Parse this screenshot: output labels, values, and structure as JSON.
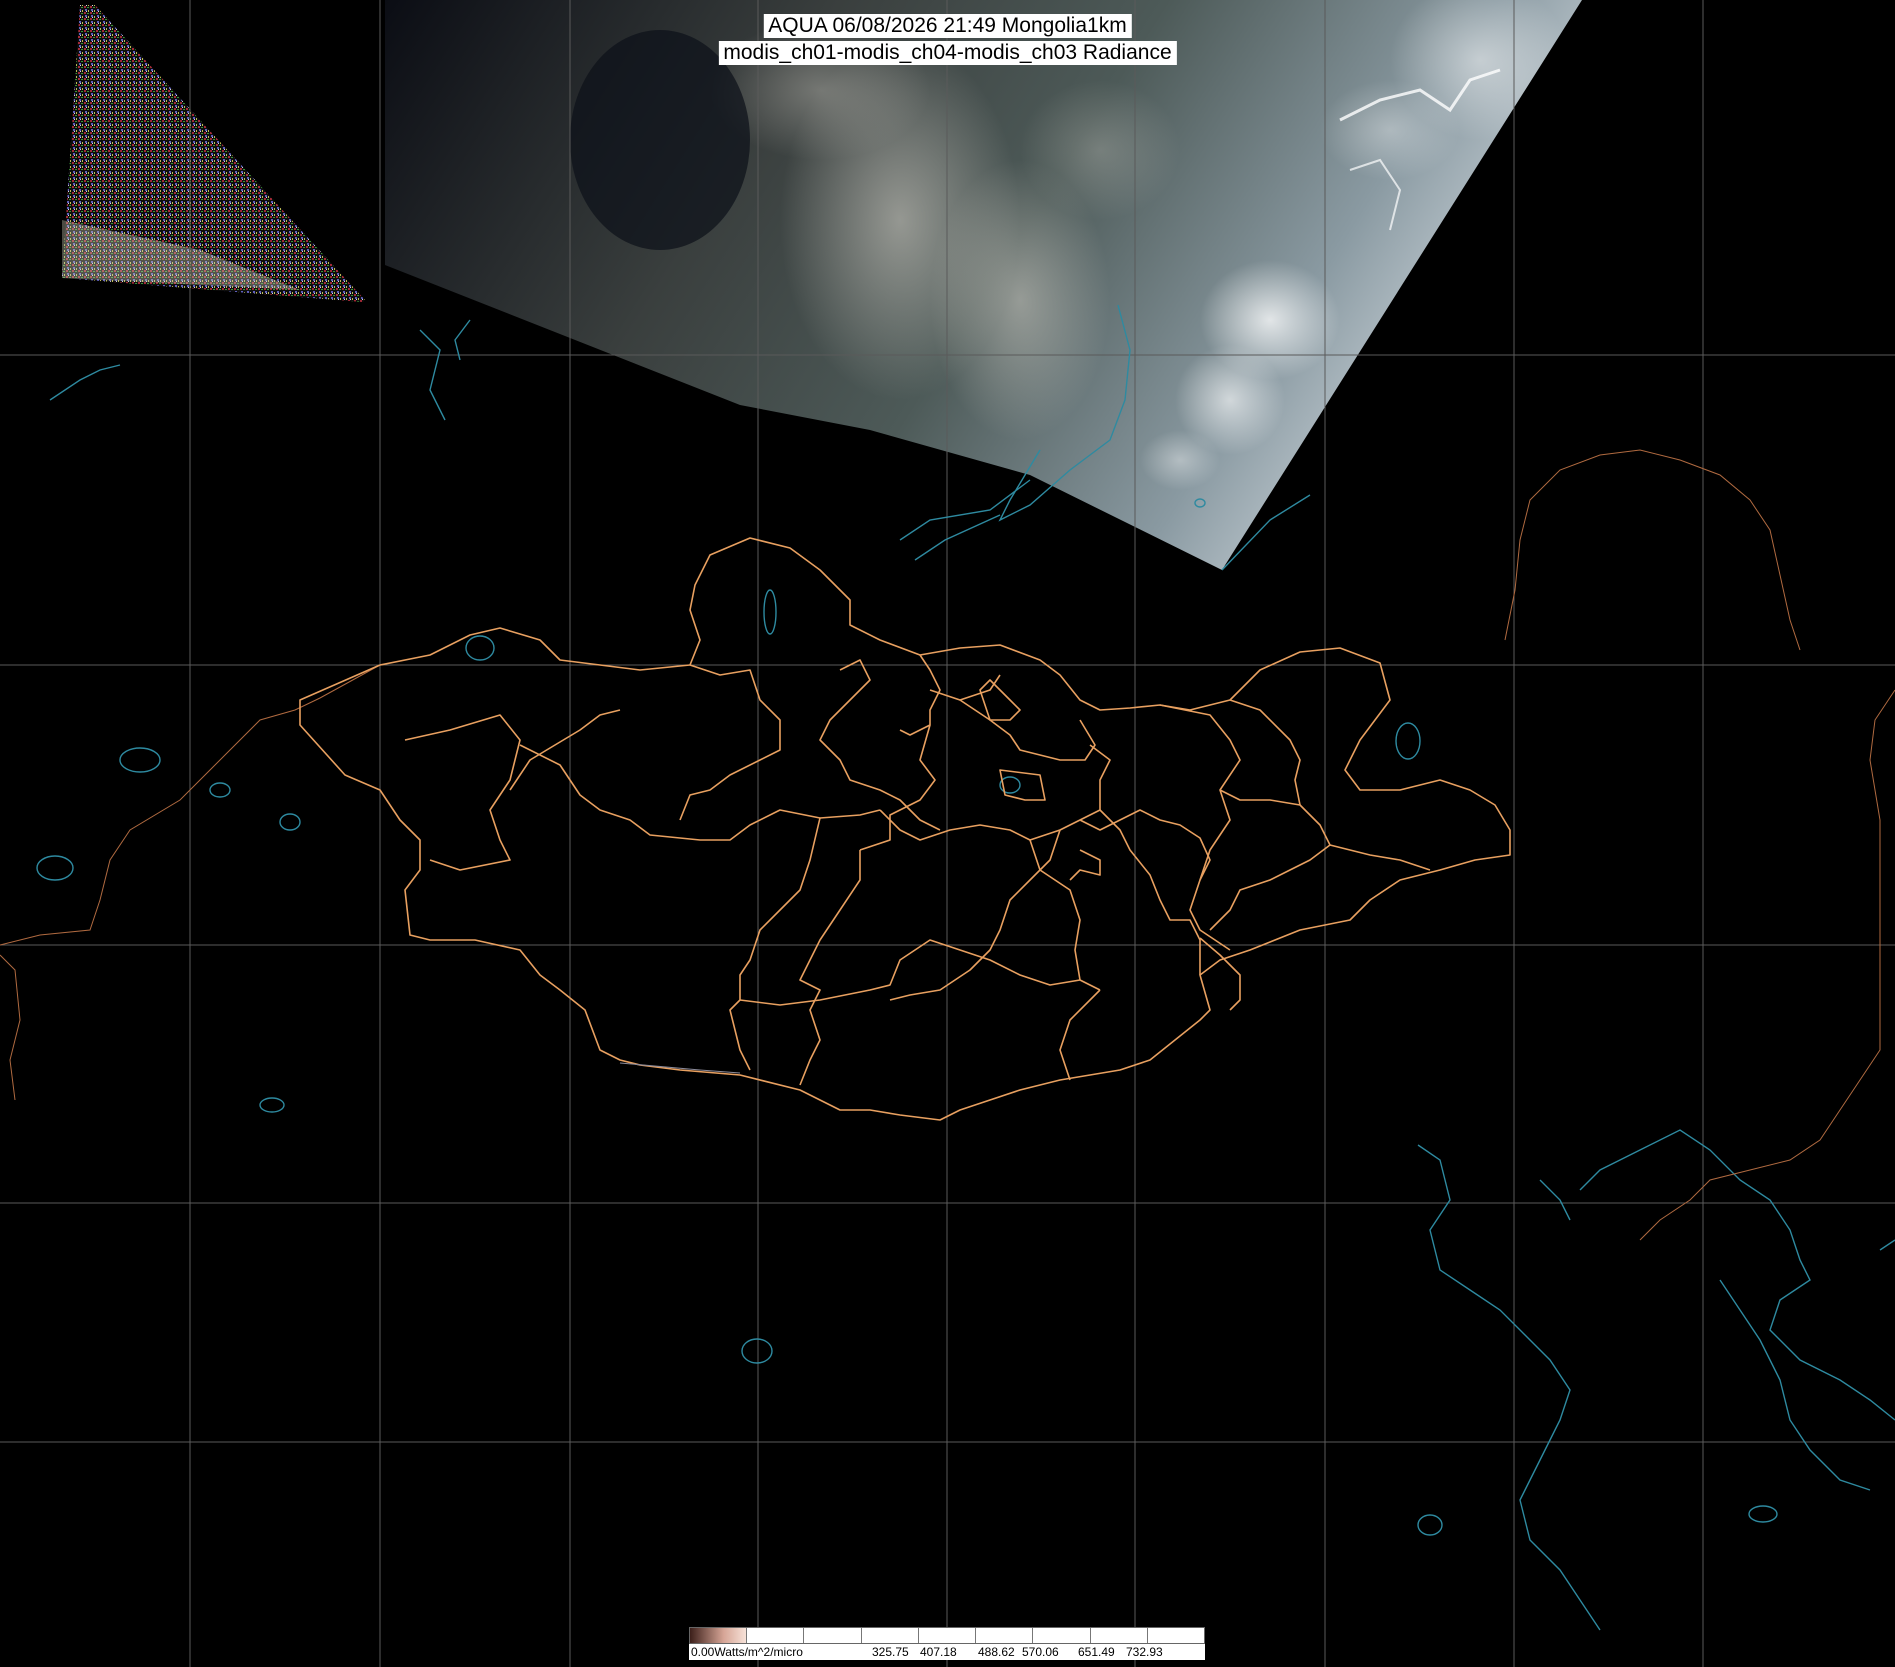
{
  "header": {
    "title_line1": "AQUA 06/08/2026 21:49 Mongolia1km",
    "title_line2": "modis_ch01-modis_ch04-modis_ch03 Radiance"
  },
  "legend": {
    "unit_label": "0.00Watts/m^2/micro",
    "ticks": [
      "325.75",
      "407.18",
      "488.62",
      "570.06",
      "651.49",
      "732.93"
    ]
  },
  "colors": {
    "background": "#000000",
    "graticule": "#5a5a5a",
    "country_border": "#e8a060",
    "coastline": "#2e8aa0",
    "admin_border": "#e8a060"
  },
  "map": {
    "region": "Mongolia1km",
    "overlays": [
      "satellite-swath",
      "graticule",
      "coastlines",
      "province-borders"
    ]
  }
}
